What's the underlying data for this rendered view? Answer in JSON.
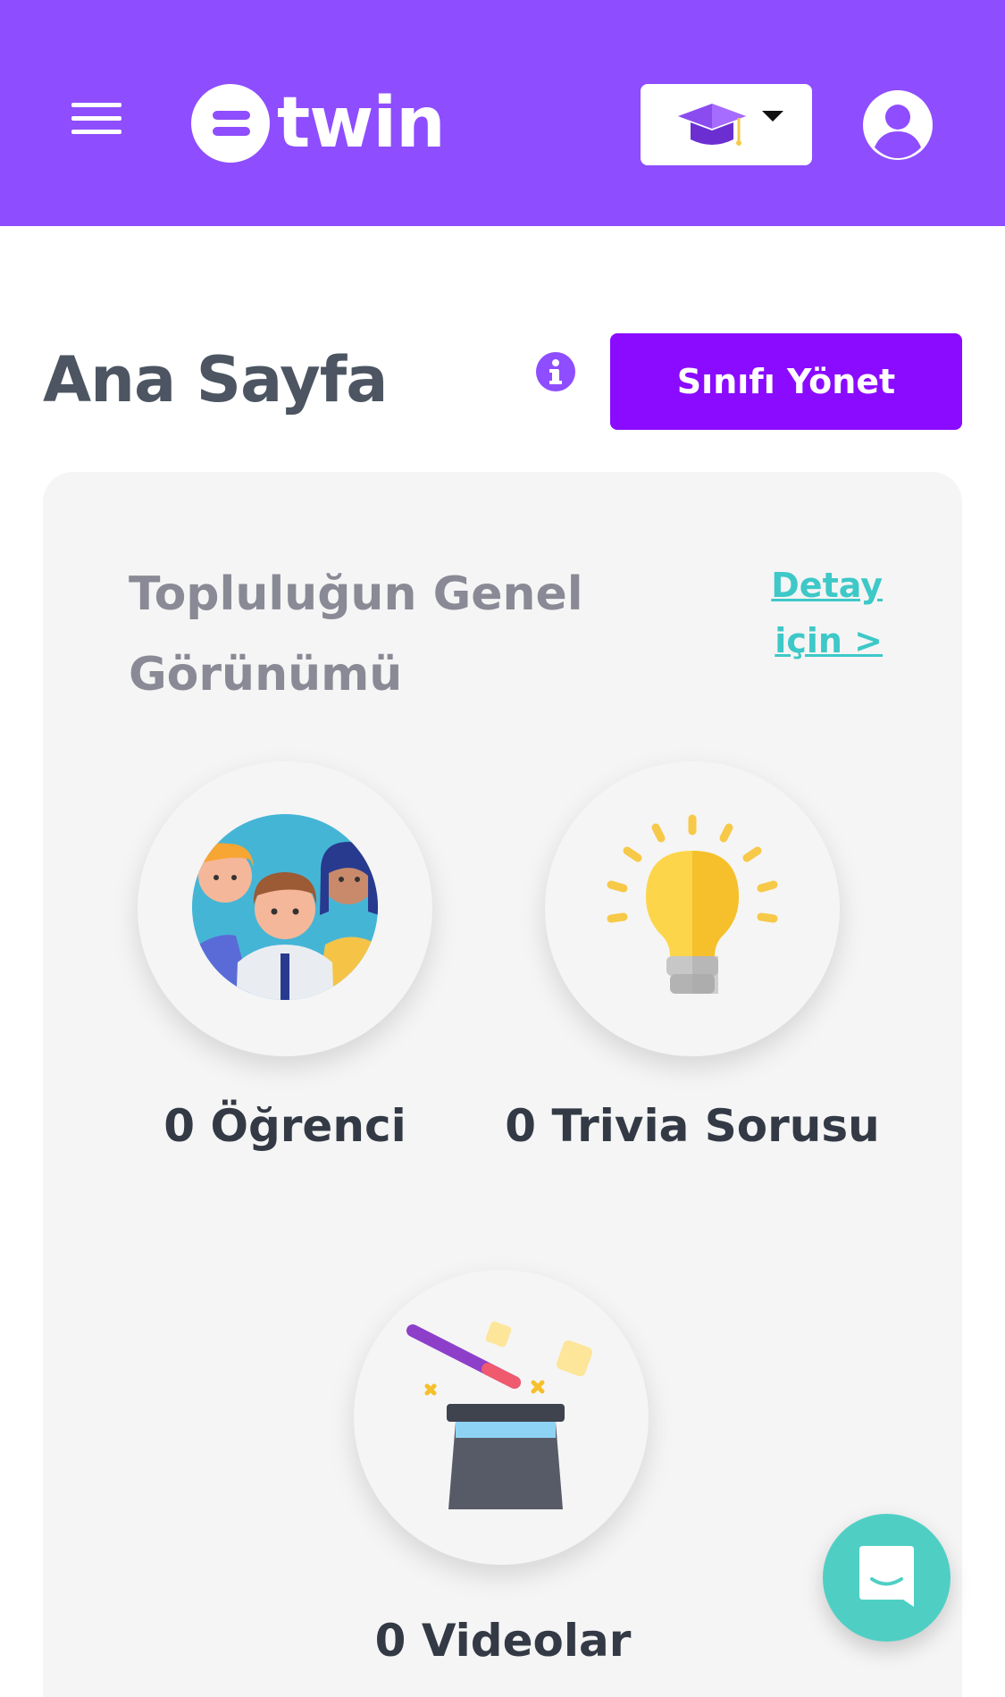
{
  "header": {
    "logo_text": "twin",
    "menu_icon": "hamburger-menu-icon",
    "class_select_icon": "graduation-cap-icon",
    "profile_icon": "user-circle-icon",
    "brand_color": "#8e4dff"
  },
  "page": {
    "title": "Ana Sayfa",
    "info_icon": "info-icon",
    "manage_button": "Sınıfı Yönet",
    "manage_button_color": "#8a0bff"
  },
  "overview": {
    "title": "Topluluğun Genel Görünümü",
    "detail_link_line1": "Detay",
    "detail_link_line2": "için >",
    "stats": [
      {
        "label": "0 Öğrenci",
        "icon": "students-group-icon"
      },
      {
        "label": "0 Trivia Sorusu",
        "icon": "lightbulb-icon"
      },
      {
        "label": "0 Videolar",
        "icon": "magic-hat-icon"
      }
    ]
  },
  "chat": {
    "icon": "chat-bubble-icon",
    "color": "#4fcfc4"
  }
}
